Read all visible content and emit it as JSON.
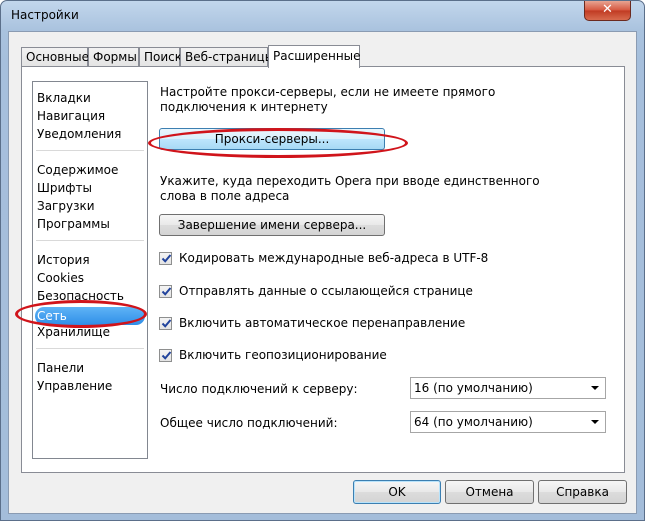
{
  "window": {
    "title": "Настройки",
    "close_label": "✕"
  },
  "tabs": [
    {
      "label": "Основные",
      "active": false
    },
    {
      "label": "Формы",
      "active": false
    },
    {
      "label": "Поиск",
      "active": false
    },
    {
      "label": "Веб-страницы",
      "active": false
    },
    {
      "label": "Расширенные",
      "active": true
    }
  ],
  "sidebar": {
    "groups": [
      [
        "Вкладки",
        "Навигация",
        "Уведомления"
      ],
      [
        "Содержимое",
        "Шрифты",
        "Загрузки",
        "Программы"
      ],
      [
        "История",
        "Cookies",
        "Безопасность",
        "Сеть",
        "Хранилище"
      ],
      [
        "Панели",
        "Управление"
      ]
    ],
    "selected": "Сеть"
  },
  "network": {
    "proxy_description": "Настройте прокси-серверы, если не имеете прямого подключения к интернету",
    "proxy_button": "Прокси-серверы...",
    "server_completion_description": "Укажите, куда переходить Opera при вводе единственного слова в поле адреса",
    "server_completion_button": "Завершение имени сервера...",
    "checkboxes": [
      {
        "label": "Кодировать международные веб-адреса в UTF-8",
        "checked": true
      },
      {
        "label": "Отправлять данные о ссылающейся странице",
        "checked": true
      },
      {
        "label": "Включить автоматическое перенаправление",
        "checked": true
      },
      {
        "label": "Включить геопозиционирование",
        "checked": true
      }
    ],
    "connections_per_server_label": "Число подключений к серверу:",
    "connections_per_server_value": "16 (по умолчанию)",
    "total_connections_label": "Общее число подключений:",
    "total_connections_value": "64 (по умолчанию)"
  },
  "footer": {
    "ok": "OK",
    "cancel": "Отмена",
    "help": "Справка"
  },
  "colors": {
    "highlight_oval": "#d0141b",
    "selection": "#2f8ee8"
  }
}
